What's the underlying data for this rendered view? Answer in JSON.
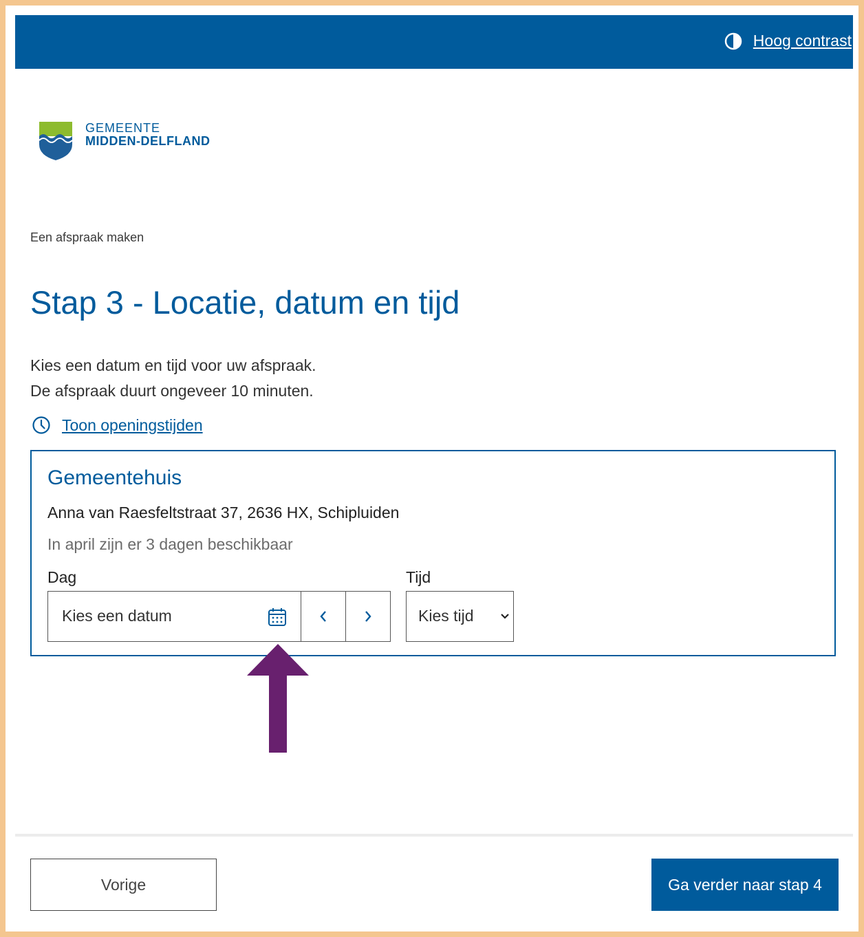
{
  "header": {
    "contrast_label": "Hoog contrast",
    "contrast_icon": "contrast-icon",
    "bar_color": "#005b9c"
  },
  "logo": {
    "line1": "GEMEENTE",
    "line2": "MIDDEN-DELFLAND",
    "icon": "municipality-shield-logo"
  },
  "breadcrumb": "Een afspraak maken",
  "page": {
    "title": "Stap 3 - Locatie, datum en tijd",
    "intro_line1": "Kies een datum en tijd voor uw afspraak.",
    "intro_line2": "De afspraak duurt ongeveer 10 minuten.",
    "hours_link": "Toon openingstijden",
    "hours_icon": "clock-icon"
  },
  "location": {
    "name": "Gemeentehuis",
    "address": "Anna van Raesfeltstraat 37, 2636 HX, Schipluiden",
    "availability": "In april zijn er 3 dagen beschikbaar",
    "day_label": "Dag",
    "date_placeholder": "Kies een datum",
    "calendar_icon": "calendar-icon",
    "prev_icon": "chevron-left-icon",
    "next_icon": "chevron-right-icon",
    "time_label": "Tijd",
    "time_placeholder": "Kies tijd",
    "time_icon": "chevron-down-icon"
  },
  "annotation": {
    "icon": "arrow-up-annotation",
    "color": "#68206e"
  },
  "footer": {
    "prev_label": "Vorige",
    "next_label": "Ga verder naar stap 4"
  },
  "colors": {
    "primary": "#005b9c",
    "frame": "#f4c68f",
    "logo_green": "#8dbb2e"
  }
}
